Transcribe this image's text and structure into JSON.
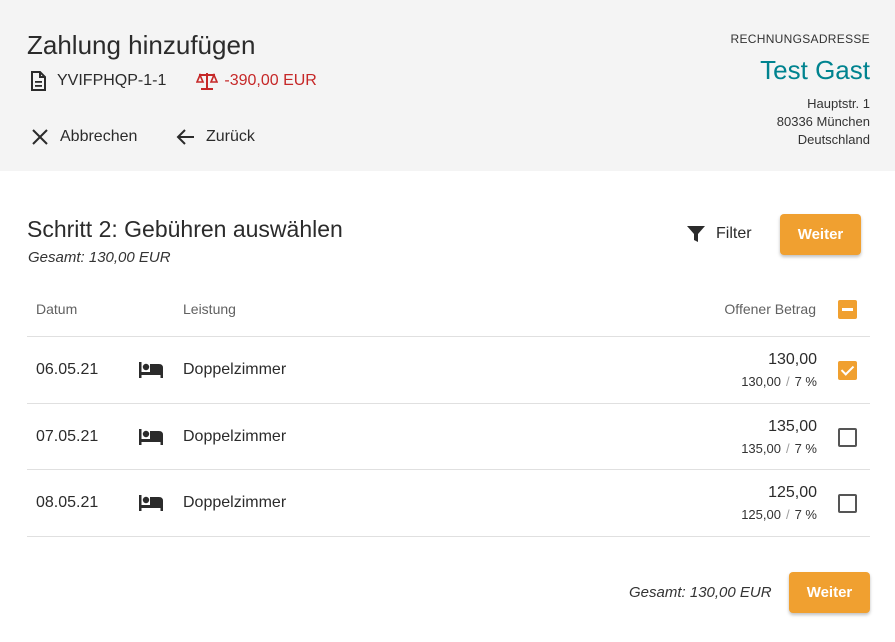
{
  "header": {
    "title": "Zahlung hinzufügen",
    "reference": "YVIFPHQP-1-1",
    "balance": "-390,00 EUR",
    "cancel_label": "Abbrechen",
    "back_label": "Zurück"
  },
  "billing": {
    "label": "RECHNUNGSADRESSE",
    "name": "Test Gast",
    "street": "Hauptstr. 1",
    "city": "80336 München",
    "country": "Deutschland"
  },
  "step": {
    "title": "Schritt 2: Gebühren auswählen",
    "total": "Gesamt: 130,00 EUR",
    "filter_label": "Filter",
    "next_label": "Weiter"
  },
  "table": {
    "headers": {
      "date": "Datum",
      "service": "Leistung",
      "amount": "Offener Betrag"
    },
    "rows": [
      {
        "date": "06.05.21",
        "service": "Doppelzimmer",
        "amount": "130,00",
        "sub_amount": "130,00",
        "tax": "7 %",
        "checked": true,
        "icon": "bed-icon"
      },
      {
        "date": "07.05.21",
        "service": "Doppelzimmer",
        "amount": "135,00",
        "sub_amount": "135,00",
        "tax": "7 %",
        "checked": false,
        "icon": "bed-icon"
      },
      {
        "date": "08.05.21",
        "service": "Doppelzimmer",
        "amount": "125,00",
        "sub_amount": "125,00",
        "tax": "7 %",
        "checked": false,
        "icon": "bed-icon"
      }
    ]
  },
  "footer": {
    "total": "Gesamt: 130,00 EUR",
    "next_label": "Weiter"
  },
  "colors": {
    "accent": "#f0a030",
    "teal": "#00838f",
    "negative": "#c62828",
    "header_bg": "#f4f4f4"
  }
}
